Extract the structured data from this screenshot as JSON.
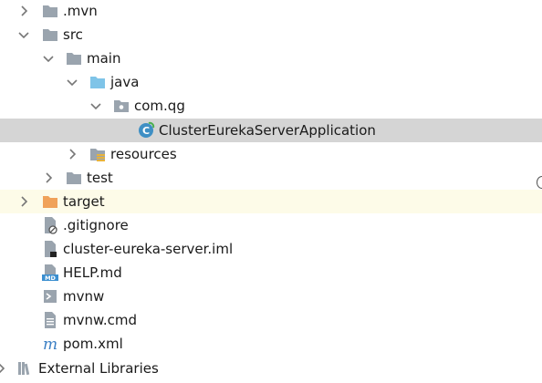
{
  "project_tree": {
    "mvn": ".mvn",
    "src": "src",
    "main": "main",
    "java": "java",
    "package": "com.qg",
    "app_class": "ClusterEurekaServerApplication",
    "resources": "resources",
    "test": "test",
    "target": "target",
    "gitignore": ".gitignore",
    "iml": "cluster-eureka-server.iml",
    "help": "HELP.md",
    "mvnw": "mvnw",
    "mvnw_cmd": "mvnw.cmd",
    "pom": "pom.xml",
    "external_libraries": "External Libraries"
  },
  "icons": {
    "help_badge": "MD",
    "pom_badge": "m"
  },
  "colors": {
    "selected_row": "#d5d5d5",
    "target_row": "#fdfbe8",
    "folder_gray": "#9aa4ae",
    "folder_source": "#7fc4e8",
    "folder_excluded": "#f0a25a",
    "class_icon": "#3f8fc4",
    "markdown_badge": "#3b8fd0",
    "maven_icon": "#3b7fc4"
  }
}
